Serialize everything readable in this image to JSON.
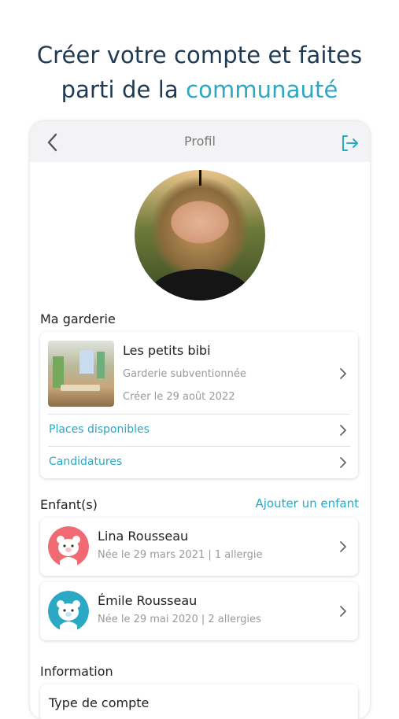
{
  "hero": {
    "line1": "Créer votre compte et faites",
    "line2_prefix": "parti de la ",
    "line2_accent": "communauté"
  },
  "colors": {
    "accent": "#2aa8c4",
    "heading": "#203a52",
    "kid1": "#f06a74",
    "kid2": "#2aa8c4"
  },
  "topbar": {
    "title": "Profil",
    "back_icon": "chevron-left-icon",
    "logout_icon": "logout-icon"
  },
  "garderie": {
    "section_label": "Ma garderie",
    "name": "Les petits bibi",
    "type": "Garderie subventionnée",
    "created": "Créer le 29 août 2022",
    "places_label": "Places disponibles",
    "candidatures_label": "Candidatures"
  },
  "enfants": {
    "section_label": "Enfant(s)",
    "add_label": "Ajouter un enfant",
    "items": [
      {
        "name": "Lina Rousseau",
        "info": "Née le 29 mars 2021  |  1 allergie"
      },
      {
        "name": "Émile Rousseau",
        "info": "Née le 29 mai 2020  |  2 allergies"
      }
    ]
  },
  "information": {
    "section_label": "Information",
    "first_row_label": "Type de compte"
  }
}
